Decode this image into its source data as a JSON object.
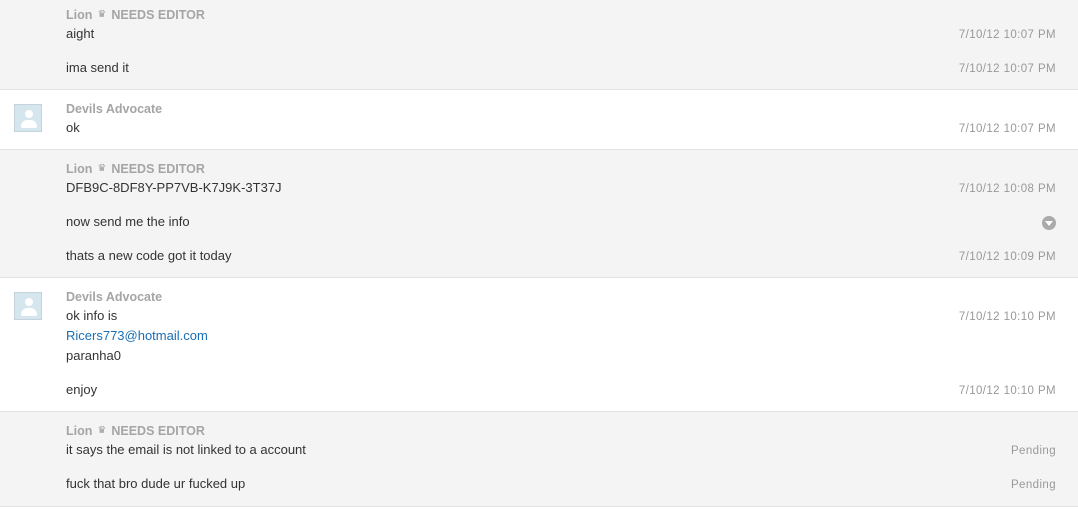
{
  "groups": [
    {
      "sender": "Lion",
      "badge": "NEEDS EDITOR",
      "messages": [
        {
          "text": "aight",
          "time": "7/10/12 10:07 PM"
        },
        {
          "text": "ima send it",
          "time": "7/10/12 10:07 PM"
        }
      ]
    },
    {
      "sender": "Devils Advocate",
      "messages": [
        {
          "text": "ok",
          "time": "7/10/12 10:07 PM"
        }
      ]
    },
    {
      "sender": "Lion",
      "badge": "NEEDS EDITOR",
      "messages": [
        {
          "text": "DFB9C-8DF8Y-PP7VB-K7J9K-3T37J",
          "time": "7/10/12 10:08 PM"
        },
        {
          "text": "now send me the info"
        },
        {
          "text": "thats a new code got it today",
          "time": "7/10/12 10:09 PM"
        }
      ]
    },
    {
      "sender": "Devils Advocate",
      "messages": [
        {
          "lines": [
            "ok info is",
            "Ricers773@hotmail.com",
            "paranha0"
          ],
          "time": "7/10/12 10:10 PM"
        },
        {
          "text": "enjoy",
          "time": "7/10/12 10:10 PM"
        }
      ]
    },
    {
      "sender": "Lion",
      "badge": "NEEDS EDITOR",
      "messages": [
        {
          "text": "it says the email is not linked to a account",
          "time": "Pending"
        },
        {
          "text": "fuck that bro dude ur fucked up",
          "time": "Pending"
        }
      ]
    }
  ],
  "icons": {
    "crown": "crown-icon",
    "avatar": "default-avatar-icon",
    "menu": "chevron-down-icon"
  }
}
